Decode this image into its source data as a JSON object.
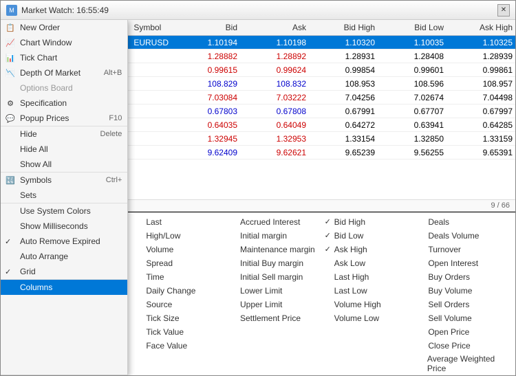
{
  "window": {
    "title": "Market Watch: 16:55:49",
    "close_label": "✕"
  },
  "table": {
    "headers": [
      "Symbol",
      "Bid",
      "Ask",
      "Bid High",
      "Bid Low",
      "Ask High"
    ],
    "rows": [
      {
        "symbol": "EURUSD",
        "bid": "1.10194",
        "ask": "1.10198",
        "bidHigh": "1.10320",
        "bidLow": "1.10035",
        "askHigh": "1.10325",
        "selected": true,
        "bidColor": "blue",
        "askColor": "blue"
      },
      {
        "symbol": "",
        "bid": "1.28882",
        "ask": "1.28892",
        "bidHigh": "1.28931",
        "bidLow": "1.28408",
        "askHigh": "1.28939",
        "selected": false,
        "bidColor": "red",
        "askColor": "red"
      },
      {
        "symbol": "",
        "bid": "0.99615",
        "ask": "0.99624",
        "bidHigh": "0.99854",
        "bidLow": "0.99601",
        "askHigh": "0.99861",
        "selected": false,
        "bidColor": "red",
        "askColor": "red"
      },
      {
        "symbol": "",
        "bid": "108.829",
        "ask": "108.832",
        "bidHigh": "108.953",
        "bidLow": "108.596",
        "askHigh": "108.957",
        "selected": false,
        "bidColor": "blue",
        "askColor": "blue"
      },
      {
        "symbol": "",
        "bid": "7.03084",
        "ask": "7.03222",
        "bidHigh": "7.04256",
        "bidLow": "7.02674",
        "askHigh": "7.04498",
        "selected": false,
        "bidColor": "red",
        "askColor": "red"
      },
      {
        "symbol": "",
        "bid": "0.67803",
        "ask": "0.67808",
        "bidHigh": "0.67991",
        "bidLow": "0.67707",
        "askHigh": "0.67997",
        "selected": false,
        "bidColor": "blue",
        "askColor": "blue"
      },
      {
        "symbol": "",
        "bid": "0.64035",
        "ask": "0.64049",
        "bidHigh": "0.64272",
        "bidLow": "0.63941",
        "askHigh": "0.64285",
        "selected": false,
        "bidColor": "red",
        "askColor": "red"
      },
      {
        "symbol": "",
        "bid": "1.32945",
        "ask": "1.32953",
        "bidHigh": "1.33154",
        "bidLow": "1.32850",
        "askHigh": "1.33159",
        "selected": false,
        "bidColor": "red",
        "askColor": "red"
      },
      {
        "symbol": "",
        "bid": "9.62409",
        "ask": "9.62621",
        "bidHigh": "9.65239",
        "bidLow": "9.56255",
        "askHigh": "9.65391",
        "selected": false,
        "bidColor": "blue",
        "askColor": "red"
      }
    ],
    "pagination": "9 / 66"
  },
  "contextMenu": {
    "items": [
      {
        "id": "new-order",
        "label": "New Order",
        "icon": "📋",
        "shortcut": ""
      },
      {
        "id": "chart-window",
        "label": "Chart Window",
        "icon": "📈",
        "shortcut": ""
      },
      {
        "id": "tick-chart",
        "label": "Tick Chart",
        "icon": "📊",
        "shortcut": ""
      },
      {
        "id": "depth-of-market",
        "label": "Depth Of Market",
        "icon": "📉",
        "shortcut": "Alt+B"
      },
      {
        "id": "options-board",
        "label": "Options Board",
        "icon": "",
        "shortcut": "",
        "disabled": true
      },
      {
        "id": "specification",
        "label": "Specification",
        "icon": "⚙",
        "shortcut": ""
      },
      {
        "id": "popup-prices",
        "label": "Popup Prices",
        "icon": "💬",
        "shortcut": "F10"
      },
      {
        "id": "hide",
        "label": "Hide",
        "icon": "",
        "shortcut": "Delete"
      },
      {
        "id": "hide-all",
        "label": "Hide All",
        "icon": "",
        "shortcut": ""
      },
      {
        "id": "show-all",
        "label": "Show All",
        "icon": "",
        "shortcut": ""
      },
      {
        "id": "symbols",
        "label": "Symbols",
        "icon": "🔣",
        "shortcut": "Ctrl+"
      },
      {
        "id": "sets",
        "label": "Sets",
        "icon": "",
        "shortcut": ""
      },
      {
        "id": "use-system-colors",
        "label": "Use System Colors",
        "icon": "",
        "shortcut": ""
      },
      {
        "id": "show-milliseconds",
        "label": "Show Milliseconds",
        "icon": "",
        "shortcut": ""
      },
      {
        "id": "auto-remove-expired",
        "label": "Auto Remove Expired",
        "icon": "",
        "shortcut": "",
        "checked": true
      },
      {
        "id": "auto-arrange",
        "label": "Auto Arrange",
        "icon": "",
        "shortcut": ""
      },
      {
        "id": "grid",
        "label": "Grid",
        "icon": "",
        "shortcut": "",
        "checked": true
      },
      {
        "id": "columns",
        "label": "Columns",
        "icon": "",
        "shortcut": "",
        "highlighted": true
      }
    ]
  },
  "columnsPanel": {
    "col1": [
      {
        "label": "Last",
        "checked": false
      },
      {
        "label": "High/Low",
        "checked": false
      },
      {
        "label": "Volume",
        "checked": false
      },
      {
        "label": "Spread",
        "checked": false
      },
      {
        "label": "Time",
        "checked": false
      },
      {
        "label": "Daily Change",
        "checked": false
      },
      {
        "label": "Source",
        "checked": false
      },
      {
        "label": "Tick Size",
        "checked": false
      },
      {
        "label": "Tick Value",
        "checked": false
      },
      {
        "label": "Face Value",
        "checked": false
      }
    ],
    "col2": [
      {
        "label": "Accrued Interest",
        "checked": false
      },
      {
        "label": "Initial margin",
        "checked": false
      },
      {
        "label": "Maintenance margin",
        "checked": false
      },
      {
        "label": "Initial Buy margin",
        "checked": false
      },
      {
        "label": "Initial Sell margin",
        "checked": false
      },
      {
        "label": "Lower Limit",
        "checked": false
      },
      {
        "label": "Upper Limit",
        "checked": false
      },
      {
        "label": "Settlement Price",
        "checked": false
      }
    ],
    "col3": [
      {
        "label": "Bid High",
        "checked": true
      },
      {
        "label": "Bid Low",
        "checked": true
      },
      {
        "label": "Ask High",
        "checked": true
      },
      {
        "label": "Ask Low",
        "checked": false
      },
      {
        "label": "Last High",
        "checked": false
      },
      {
        "label": "Last Low",
        "checked": false
      },
      {
        "label": "Volume High",
        "checked": false
      },
      {
        "label": "Volume Low",
        "checked": false
      }
    ],
    "col4": [
      {
        "label": "Deals",
        "checked": false
      },
      {
        "label": "Deals Volume",
        "checked": false
      },
      {
        "label": "Turnover",
        "checked": false
      },
      {
        "label": "Open Interest",
        "checked": false
      },
      {
        "label": "Buy Orders",
        "checked": false
      },
      {
        "label": "Buy Volume",
        "checked": false
      },
      {
        "label": "Sell Orders",
        "checked": false
      },
      {
        "label": "Sell Volume",
        "checked": false
      },
      {
        "label": "Open Price",
        "checked": false
      },
      {
        "label": "Close Price",
        "checked": false
      },
      {
        "label": "Average Weighted Price",
        "checked": false
      }
    ]
  }
}
